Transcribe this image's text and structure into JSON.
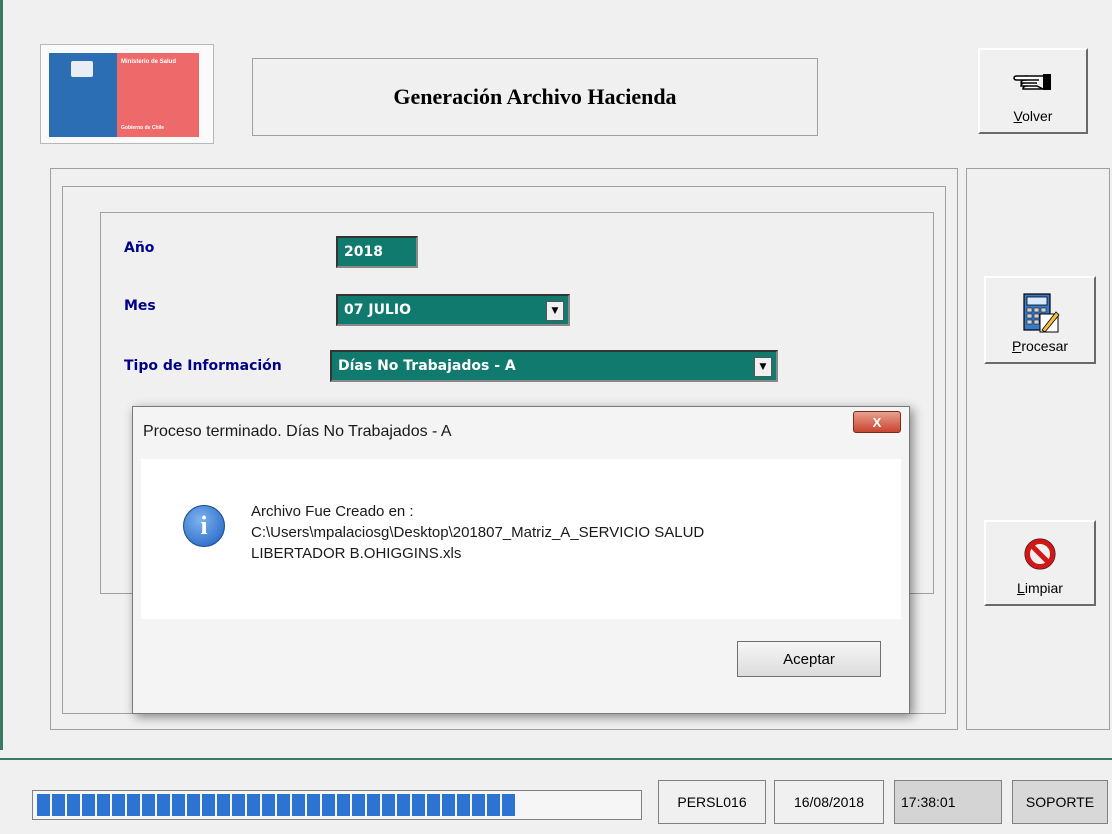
{
  "logo": {
    "ministry": "Ministerio de Salud",
    "government": "Gobierno de Chile"
  },
  "header": {
    "title": "Generación Archivo Hacienda"
  },
  "buttons": {
    "volver": {
      "label_mnemonic": "V",
      "label_rest": "olver",
      "icon": "pointing-hand-icon"
    },
    "procesar": {
      "label_mnemonic": "P",
      "label_rest": "rocesar",
      "icon": "calculator-icon"
    },
    "limpiar": {
      "label_mnemonic": "L",
      "label_rest": "impiar",
      "icon": "no-symbol-icon"
    }
  },
  "form": {
    "anio_label": "Año",
    "anio_value": "2018",
    "mes_label": "Mes",
    "mes_value": "07 JULIO",
    "tipo_label": "Tipo de Información",
    "tipo_value": "Días No Trabajados - A"
  },
  "dialog": {
    "title": "Proceso terminado. Días No Trabajados - A",
    "close_label": "X",
    "message_line1": "Archivo Fue Creado en :",
    "message_line2": "C:\\Users\\mpalaciosg\\Desktop\\201807_Matriz_A_SERVICIO SALUD",
    "message_line3": "LIBERTADOR B.OHIGGINS.xls",
    "ok_label": "Aceptar",
    "icon": "info-icon"
  },
  "status": {
    "progress_fraction": 0.81,
    "user": "PERSL016",
    "date": "16/08/2018",
    "time": "17:38:01",
    "role": "SOPORTE"
  },
  "colors": {
    "field_bg": "#107a6e",
    "label_color": "#00008b",
    "progress_color": "#2d74d2",
    "accent_rule": "#3a7a60"
  }
}
